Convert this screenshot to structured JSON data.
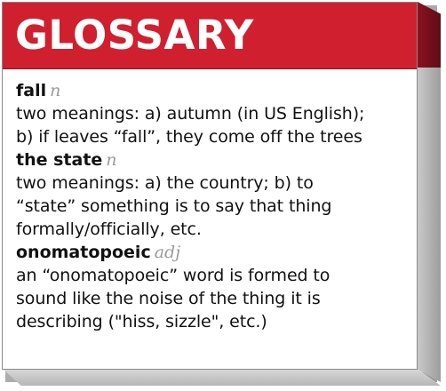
{
  "header": {
    "title": "GLOSSARY",
    "color": "#d0202f"
  },
  "entries": [
    {
      "term": "fall",
      "pos": "n",
      "definition_lines": [
        "two meanings: a) autumn (in US English);",
        "b) if leaves “fall”, they come off the trees"
      ]
    },
    {
      "term": "the state",
      "pos": "n",
      "definition_lines": [
        "two meanings: a) the country; b) to",
        "“state” something is to say that thing",
        "formally/officially, etc."
      ]
    },
    {
      "term": "onomatopoeic",
      "pos": "adj",
      "definition_lines": [
        "an “onomatopoeic” word is formed to",
        "sound like the noise of the thing it is",
        "describing (\"hiss, sizzle\", etc.)"
      ]
    }
  ]
}
